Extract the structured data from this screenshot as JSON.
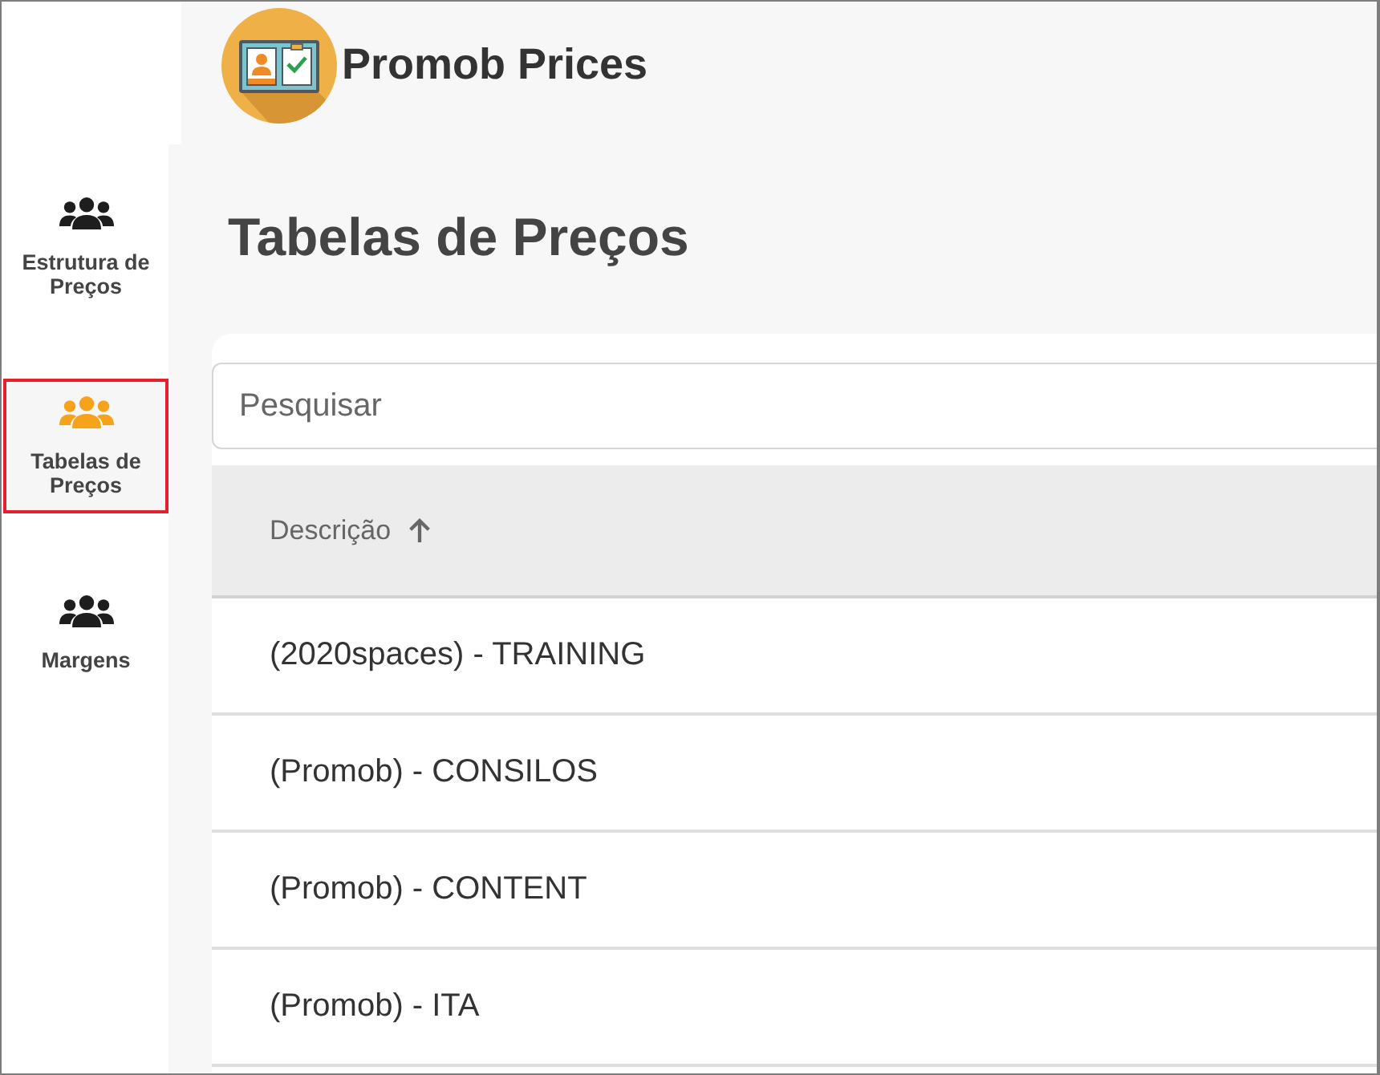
{
  "header": {
    "app_name": "Promob Prices"
  },
  "sidebar": {
    "items": [
      {
        "label": "Estrutura de Preços",
        "selected": false
      },
      {
        "label": "Tabelas de Preços",
        "selected": true
      },
      {
        "label": "Margens",
        "selected": false
      }
    ]
  },
  "page": {
    "title": "Tabelas de Preços"
  },
  "search": {
    "placeholder": "Pesquisar"
  },
  "table": {
    "columns": [
      {
        "label": "Descrição",
        "sorted": true
      }
    ],
    "rows": [
      {
        "description": "(2020spaces) - TRAINING"
      },
      {
        "description": "(Promob) - CONSILOS"
      },
      {
        "description": "(Promob) - CONTENT"
      },
      {
        "description": "(Promob) - ITA"
      }
    ]
  }
}
